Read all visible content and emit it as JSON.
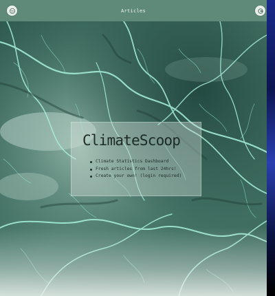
{
  "header": {
    "title": "Articles",
    "left_icon": "globe-logo-icon",
    "right_icon": "google-signin-icon"
  },
  "hero": {
    "title": "ClimateScoop",
    "features": [
      "Climate Statistics Dashboard",
      "Fresh articles from last 24hrs!",
      "Create your own! (login required)"
    ]
  },
  "colors": {
    "header_bg": "#5f8a7a",
    "terrain_base": "#3f6f63",
    "river_glow": "#9ff0d8",
    "card_bg": "#cddcd4"
  }
}
